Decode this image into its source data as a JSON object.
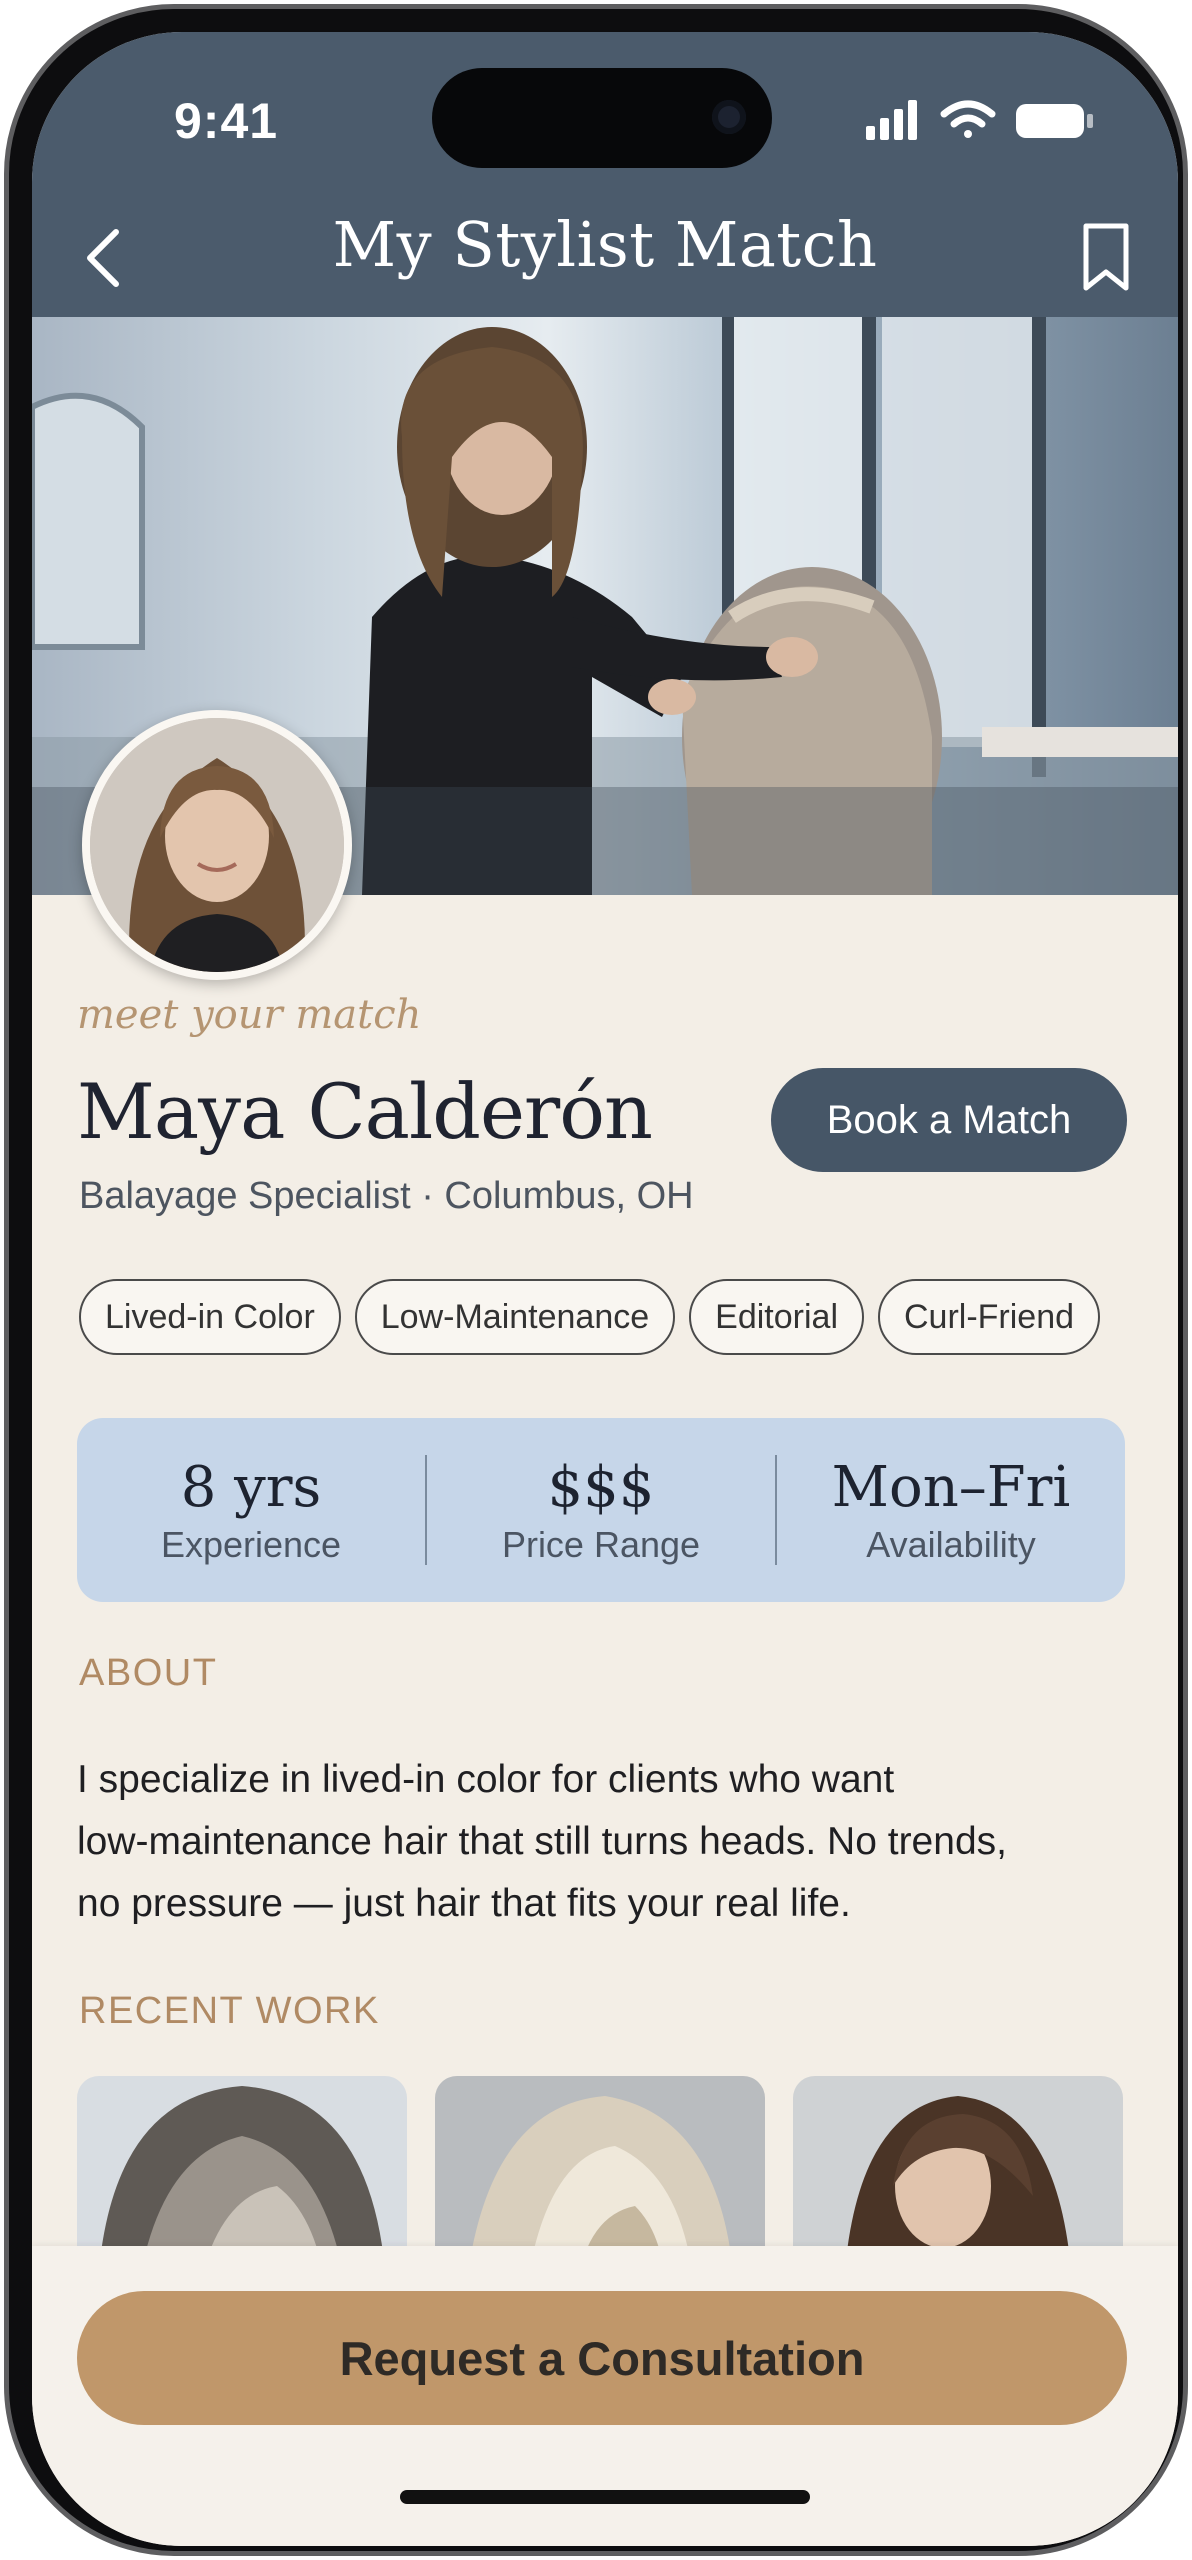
{
  "status_bar": {
    "time": "9:41"
  },
  "header": {
    "title": "My Stylist Match"
  },
  "profile": {
    "tagline": "meet your match",
    "name": "Maya Calderón",
    "subtitle": "Balayage Specialist · Columbus, OH",
    "book_button": "Book a Match",
    "tags": [
      "Lived-in Color",
      "Low-Maintenance",
      "Editorial",
      "Curl-Friend"
    ]
  },
  "stats": [
    {
      "value": "8 yrs",
      "label": "Experience"
    },
    {
      "value": "$$$",
      "label": "Price Range"
    },
    {
      "value": "Mon–Fri",
      "label": "Availability"
    }
  ],
  "about": {
    "heading": "ABOUT",
    "lines": [
      "I specialize in lived-in color for clients who want",
      "low-maintenance hair that still turns heads. No trends,",
      "no pressure — just hair that fits your real life."
    ]
  },
  "recent_work": {
    "heading": "RECENT WORK"
  },
  "cta": {
    "label": "Request a Consultation"
  },
  "colors": {
    "header_bg": "#4b5b6c",
    "accent_gold": "#c0976a",
    "stats_bg": "#c6d6e9",
    "page_bg": "#f3eee6"
  },
  "icons": [
    "back-chevron-icon",
    "bookmark-icon",
    "signal-icon",
    "wifi-icon",
    "battery-icon"
  ]
}
